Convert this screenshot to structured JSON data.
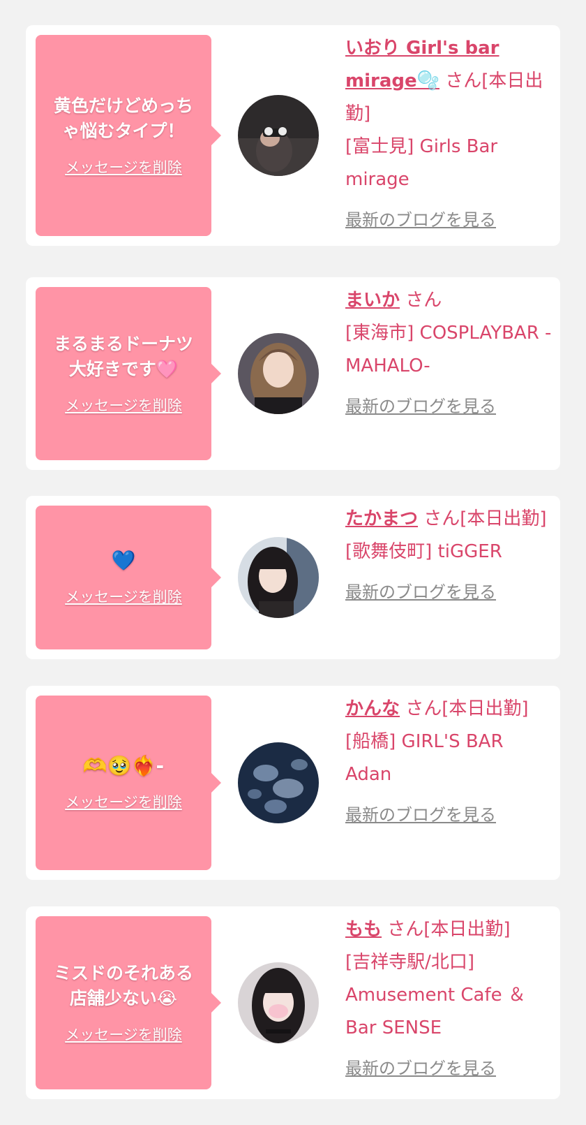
{
  "colors": {
    "accent": "#d9456a",
    "bubble": "#ff94a6",
    "background": "#f2f2f2"
  },
  "cards": [
    {
      "message": "黄色だけどめっち\nゃ悩むタイプ！",
      "delete_label": "メッセージを削除",
      "name": "いおり Girl's bar mirage🫧",
      "honorific": "さん[本日出勤]",
      "shop": "[富士見] Girls Bar mirage",
      "blog_label": "最新のブログを見る"
    },
    {
      "message": "まるまるドーナツ\n大好きです🩷",
      "delete_label": "メッセージを削除",
      "name": "まいか",
      "honorific": "さん",
      "shop": "[東海市] COSPLAYBAR -MAHALO-",
      "blog_label": "最新のブログを見る"
    },
    {
      "message": "💙",
      "delete_label": "メッセージを削除",
      "name": "たかまつ",
      "honorific": "さん[本日出勤]",
      "shop": "[歌舞伎町] tiGGER",
      "blog_label": "最新のブログを見る"
    },
    {
      "message": "🫶🥹❤️‍🔥-",
      "delete_label": "メッセージを削除",
      "name": "かんな",
      "honorific": "さん[本日出勤]",
      "shop": "[船橋] GIRL'S BAR Adan",
      "blog_label": "最新のブログを見る"
    },
    {
      "message": "ミスドのそれある\n店舗少ない😭",
      "delete_label": "メッセージを削除",
      "name": "もも",
      "honorific": "さん[本日出勤]",
      "shop": "[吉祥寺駅/北口] Amusement Cafe ＆Bar SENSE",
      "blog_label": "最新のブログを見る"
    }
  ]
}
